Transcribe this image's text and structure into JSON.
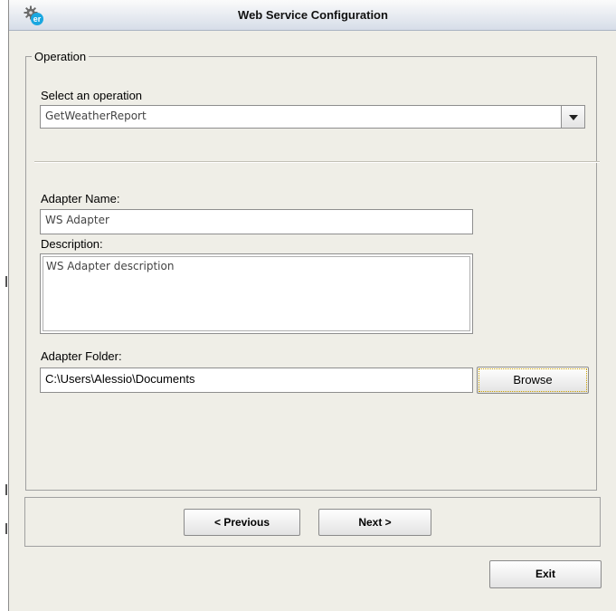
{
  "window": {
    "title": "Web Service Configuration",
    "icon_badge": "er"
  },
  "operation_group": {
    "legend": "Operation",
    "select_label": "Select an operation",
    "selected_operation": "GetWeatherReport"
  },
  "adapter": {
    "name_label": "Adapter Name:",
    "name_value": "WS Adapter",
    "description_label": "Description:",
    "description_value": "WS Adapter description",
    "folder_label": "Adapter Folder:",
    "folder_value": "C:\\Users\\Alessio\\Documents",
    "browse_label": "Browse"
  },
  "navigation": {
    "previous_label": "< Previous",
    "next_label": "Next >",
    "exit_label": "Exit"
  },
  "icons": [
    "gear-icon",
    "dropdown-arrow-icon"
  ],
  "colors": {
    "window_bg": "#efeee7",
    "badge": "#19a7e0",
    "field_bg": "#ffffff"
  }
}
